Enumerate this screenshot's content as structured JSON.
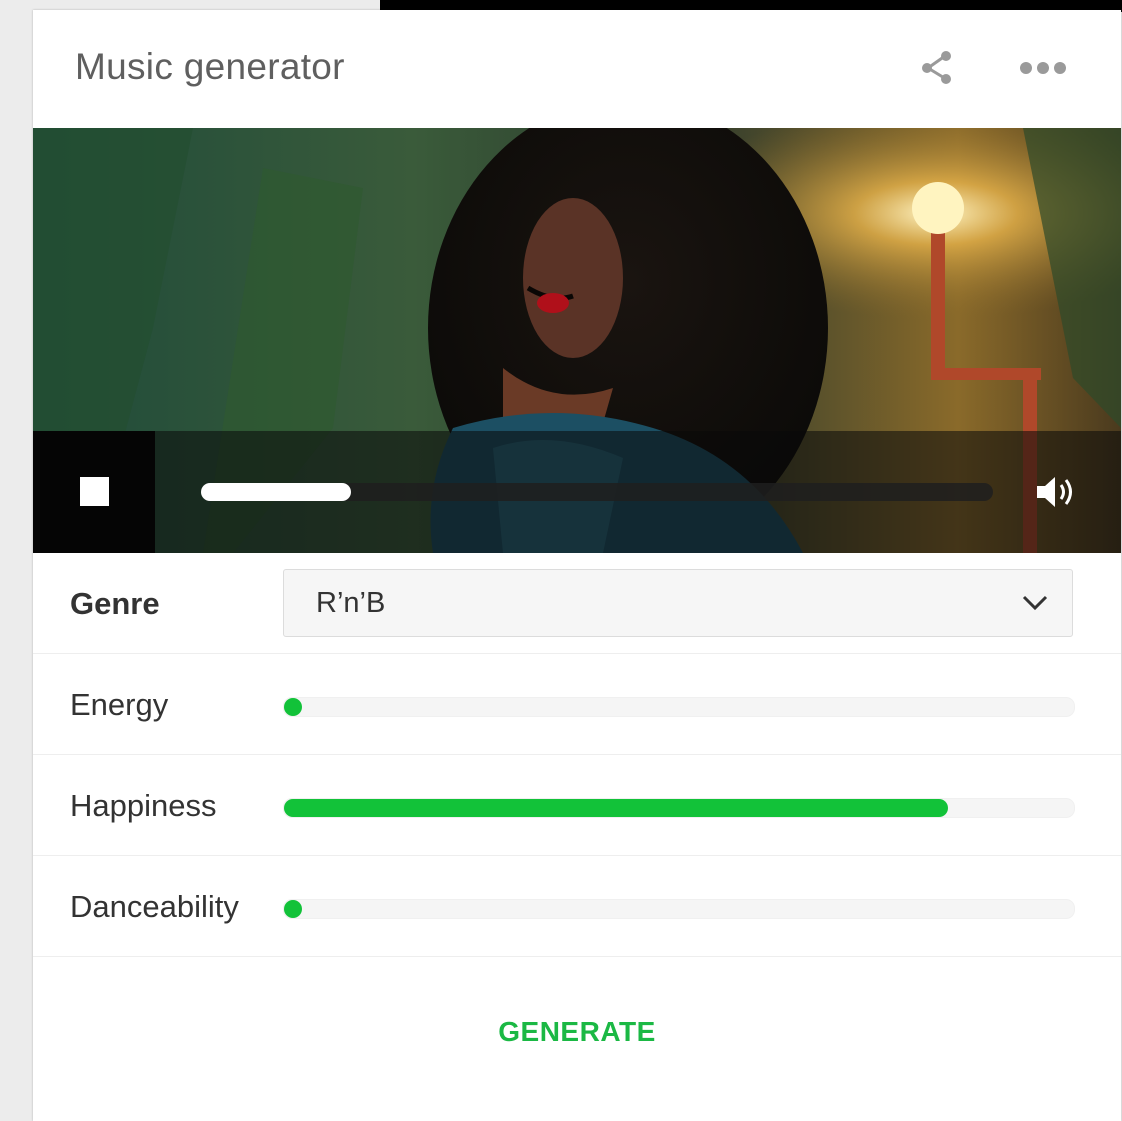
{
  "app": {
    "title": "Music generator"
  },
  "header": {
    "share_icon": "share-icon",
    "more_icon": "more-horizontal-icon"
  },
  "player": {
    "stop_icon": "stop-icon",
    "volume_icon": "volume-icon",
    "progress": 0.19
  },
  "form": {
    "genre": {
      "label": "Genre",
      "value": "R’n’B",
      "icon": "chevron-down-icon"
    },
    "energy": {
      "label": "Energy",
      "value": 0.0
    },
    "happiness": {
      "label": "Happiness",
      "value": 0.84
    },
    "danceability": {
      "label": "Danceability",
      "value": 0.0
    }
  },
  "actions": {
    "generate_label": "GENERATE"
  },
  "colors": {
    "accent": "#12c239",
    "accent_text": "#1bb844",
    "title_text": "#5f5f5f",
    "label_text": "#333333"
  }
}
